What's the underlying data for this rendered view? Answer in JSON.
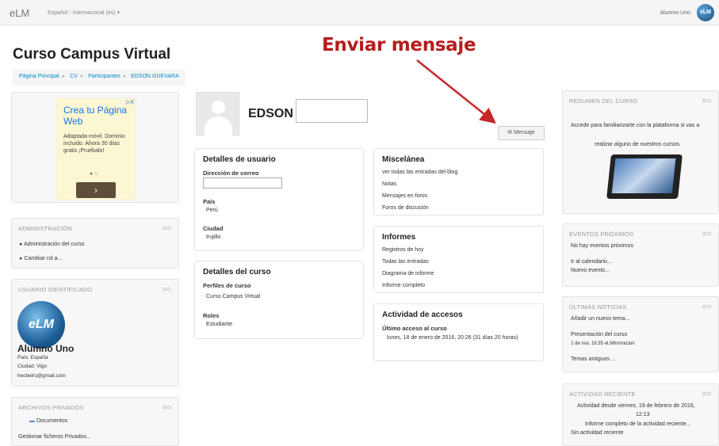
{
  "topbar": {
    "brand": "eLM",
    "language": "Español - Internacional (es) ▾",
    "user_name": "Alumno Uno",
    "avatar_text": "eLM"
  },
  "page": {
    "course_title": "Curso Campus Virtual",
    "breadcrumb": [
      "Página Principal",
      "CV",
      "Participantes",
      "EDSON GUEVARA"
    ],
    "annotation": "Enviar mensaje",
    "accent_color": "#b71c1c",
    "link_color": "#0088cc"
  },
  "ad": {
    "title": "Crea tu Página Web",
    "body": "Adaptada móvil. Dominio incluido. Ahora 30 días gratis ¡Pruébalo!",
    "dots": "● ○",
    "button": "›",
    "close": "▷X"
  },
  "admin": {
    "title": "ADMINISTRACIÓN",
    "items": [
      "Administración del curso",
      "Cambiar rol a..."
    ]
  },
  "identified_user": {
    "title": "USUARIO IDENTIFICADO",
    "avatar_text": "eLM",
    "name": "Alumno Uno",
    "country": "País: España",
    "city": "Ciudad: Vigo",
    "email": "hecbelrs@gmail.com"
  },
  "private_files": {
    "title": "ARCHIVOS PRIVADOS",
    "folder": "Documentos",
    "manage": "Gestionar ficheros Privados..."
  },
  "profile": {
    "name": "EDSON",
    "message_button": "✉ Mensaje"
  },
  "user_details": {
    "title": "Detalles de usuario",
    "email_label": "Dirección de correo",
    "country_label": "País",
    "country": "Perú",
    "city_label": "Ciudad",
    "city": "trujillo"
  },
  "course_details": {
    "title": "Detalles del curso",
    "profiles_label": "Perfiles de curso",
    "profiles": "Curso Campus Virtual",
    "roles_label": "Roles",
    "roles": "Estudiante"
  },
  "misc": {
    "title": "Miscelánea",
    "links": [
      "ver todas las entradas del blog",
      "Notas",
      "Mensajes en foros",
      "Foros de discusión"
    ]
  },
  "reports": {
    "title": "Informes",
    "links": [
      "Registros de hoy",
      "Todas las entradas",
      "Diagrama de informe",
      "Informe completo"
    ]
  },
  "access": {
    "title": "Actividad de accesos",
    "last_label": "Último acceso al curso",
    "last_value": "lunes, 18 de enero de 2016, 20:26  (31 días 20 horas)"
  },
  "course_summary": {
    "title": "RESUMEN DEL CURSO",
    "line1": "Accede  para familiarizarte con la plataforma si vas a",
    "line2": "realizar alguno de nuestros cursos."
  },
  "events": {
    "title": "EVENTOS PRÓXIMOS",
    "none": "No hay eventos próximos",
    "calendar": "Ir al calendario...",
    "new_event": "Nuevo evento..."
  },
  "news": {
    "title": "ÚLTIMAS NOTICIAS",
    "add": "Añadir un nuevo tema...",
    "item_title": "Presentación del curso",
    "item_meta": "2 de nov, 16:35  eLMformacion",
    "old": "Temas antiguos ..."
  },
  "recent": {
    "title": "ACTIVIDAD RECIENTE",
    "since": "Actividad desde viernes, 19 de febrero de 2016,",
    "time": "12:13",
    "report": "Informe completo de la actividad reciente...",
    "none": "Sin actividad reciente"
  },
  "block_controls": "⊟⊡"
}
